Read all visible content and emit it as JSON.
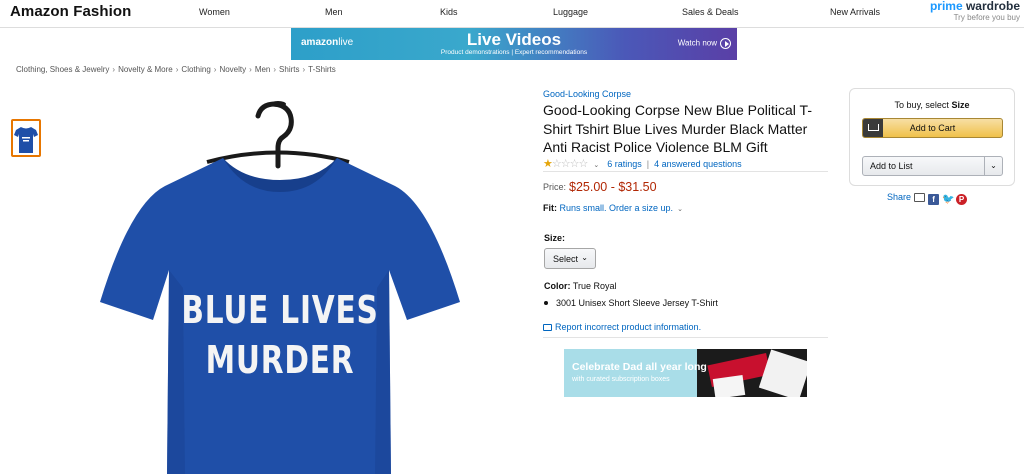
{
  "nav": {
    "brand": "Amazon Fashion",
    "links": [
      "Women",
      "Men",
      "Kids",
      "Luggage",
      "Sales & Deals",
      "New Arrivals"
    ],
    "prime_wardrobe": {
      "prime": "prime",
      "wardrobe": " wardrobe",
      "sub": "Try before you buy"
    }
  },
  "banner": {
    "logo_a": "amazon",
    "logo_b": "live",
    "title": "Live Videos",
    "subtitle": "Product demonstrations  |  Expert recommendations",
    "cta": "Watch now"
  },
  "breadcrumb": [
    "Clothing, Shoes & Jewelry",
    "Novelty & More",
    "Clothing",
    "Novelty",
    "Men",
    "Shirts",
    "T-Shirts"
  ],
  "shirt_text": {
    "line1": "BLUE LIVES",
    "line2": "MURDER"
  },
  "product": {
    "brand": "Good-Looking Corpse",
    "title": "Good-Looking Corpse New Blue Political T-Shirt Tshirt Blue Lives Murder Black Matter Anti Racist Police Violence BLM Gift",
    "rating_stars": 1,
    "ratings": "6 ratings",
    "answered": "4 answered questions",
    "price_label": "Price:",
    "price": "$25.00 - $31.50",
    "fit_label": "Fit:",
    "fit_value": "Runs small. Order a size up.",
    "size_label": "Size:",
    "size_select": "Select",
    "color_label": "Color:",
    "color_value": "True Royal",
    "bullet": "3001 Unisex Short Sleeve Jersey T-Shirt",
    "report": "Report incorrect product information."
  },
  "ad": {
    "title": "Celebrate Dad all year long",
    "sub": "with curated subscription boxes"
  },
  "buybox": {
    "to_buy": "To buy, select",
    "to_buy_bold": "Size",
    "add_to_cart": "Add to Cart",
    "add_to_list": "Add to List"
  },
  "share": {
    "label": "Share"
  },
  "colors": {
    "shirt": "#1f4fa8",
    "link": "#0066c0",
    "price": "#b12704",
    "cart_button": "#f0c14b",
    "thumb_border": "#e77600"
  }
}
